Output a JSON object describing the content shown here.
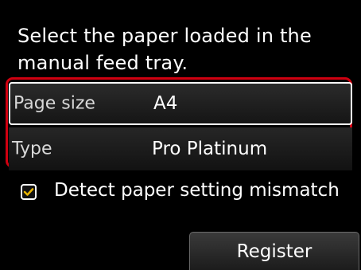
{
  "message": "Select the paper loaded in the manual feed tray.",
  "settings": {
    "page_size": {
      "label": "Page size",
      "value": "A4"
    },
    "type": {
      "label": "Type",
      "value": "Pro Platinum"
    }
  },
  "detect_mismatch": {
    "label": "Detect paper setting mismatch",
    "checked": true,
    "icon": "checkmark-icon"
  },
  "buttons": {
    "register": "Register"
  },
  "colors": {
    "screen_background": "#000000",
    "highlight_frame": "#d00010",
    "checkmark": "#e8b400",
    "text": "#ffffff"
  }
}
